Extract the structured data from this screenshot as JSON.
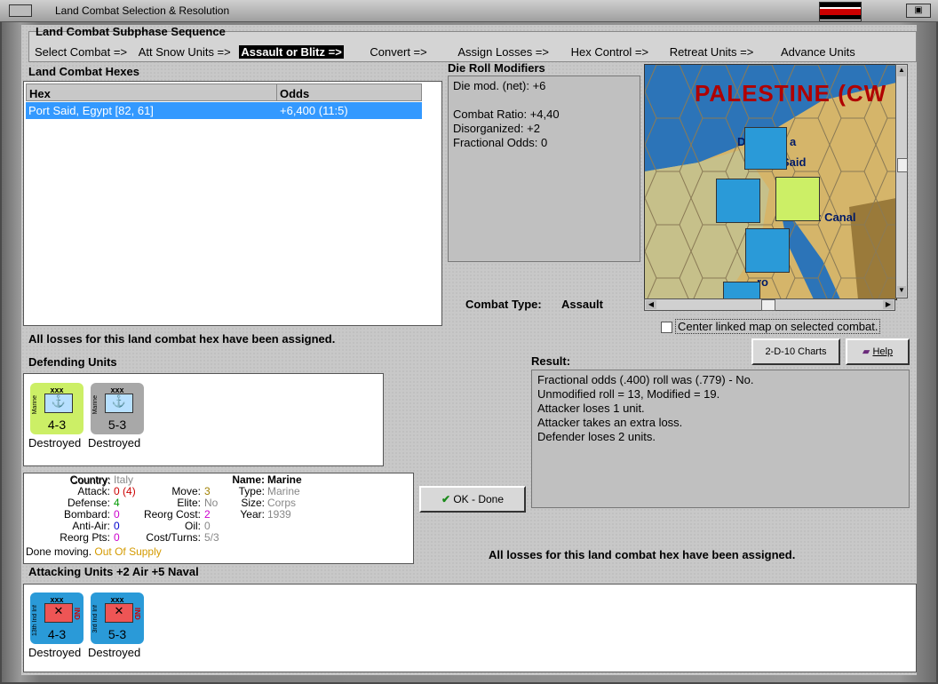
{
  "window": {
    "title": "Land Combat Selection & Resolution"
  },
  "sequence": {
    "title": "Land Combat Subphase Sequence",
    "steps": [
      "Select Combat =>",
      "Att Snow Units =>",
      "Assault or Blitz =>",
      "Convert =>",
      "Assign Losses =>",
      "Hex Control =>",
      "Retreat Units =>",
      "Advance Units"
    ],
    "active_index": 2
  },
  "hexes": {
    "title": "Land Combat Hexes",
    "col_hex": "Hex",
    "col_odds": "Odds",
    "rows": [
      {
        "hex": "Port Said, Egypt [82, 61]",
        "odds": "+6,400 (11:5)"
      }
    ]
  },
  "modifiers": {
    "title": "Die Roll Modifiers",
    "lines": [
      "Die mod. (net): +6",
      "",
      "Combat Ratio: +4,40",
      "Disorganized: +2",
      "Fractional Odds: 0"
    ]
  },
  "map": {
    "title_text": "PALESTINE (CW",
    "labels": [
      "Da",
      "a",
      "rt Said",
      "z Canal",
      "ro"
    ],
    "center_checkbox_label": "Center linked map on selected combat."
  },
  "combat_type": {
    "label": "Combat Type:",
    "value": "Assault"
  },
  "losses_msg_top": "All losses for this land combat hex have been assigned.",
  "losses_msg_bottom": "All losses for this land combat hex have been assigned.",
  "buttons": {
    "charts": "2-D-10 Charts",
    "help": "Help",
    "ok": "OK - Done"
  },
  "result": {
    "label": "Result:",
    "lines": [
      "Fractional odds (.400) roll was (.779)  - No.",
      "Unmodified roll = 13, Modified = 19.",
      "Attacker loses 1 unit.",
      "Attacker takes an extra loss.",
      "Defender loses 2 units."
    ]
  },
  "defending": {
    "title": "Defending Units",
    "units": [
      {
        "level": "xxx",
        "side": "Marine",
        "strength": "4-3",
        "status": "Destroyed",
        "color": "#ccef66"
      },
      {
        "level": "xxx",
        "side": "Marine",
        "strength": "5-3",
        "status": "Destroyed",
        "color": "#a8a8a8"
      }
    ]
  },
  "unit_info": {
    "country_label": "Country:",
    "country": "Italy",
    "attack_label": "Attack:",
    "attack": "0",
    "attack_paren": "(4)",
    "defense_label": "Defense:",
    "defense": "4",
    "bombard_label": "Bombard:",
    "bombard": "0",
    "antiair_label": "Anti-Air:",
    "antiair": "0",
    "reorgpts_label": "Reorg Pts:",
    "reorgpts": "0",
    "done_moving": "Done moving.",
    "supply": "Out Of Supply",
    "move_label": "Move:",
    "move": "3",
    "elite_label": "Elite:",
    "elite": "No",
    "reorgcost_label": "Reorg Cost:",
    "reorgcost": "2",
    "oil_label": "Oil:",
    "oil": "0",
    "costturns_label": "Cost/Turns:",
    "costturns": "5/3",
    "name_label": "Name:",
    "name": "Marine",
    "type_label": "Type:",
    "type": "Marine",
    "size_label": "Size:",
    "size": "Corps",
    "year_label": "Year:",
    "year": "1939"
  },
  "attacking": {
    "title": "Attacking Units +2 Air +5 Naval",
    "units": [
      {
        "level": "xxx",
        "side": "13th Ind Inf",
        "tag": "IND",
        "strength": "4-3",
        "status": "Destroyed"
      },
      {
        "level": "xxx",
        "side": "3rd Ind Inf",
        "tag": "IND",
        "strength": "5-3",
        "status": "Destroyed"
      }
    ]
  },
  "colors": {
    "selection": "#3399ff",
    "counter_blue": "#2a9ad8",
    "accent_green": "#ccef66"
  }
}
